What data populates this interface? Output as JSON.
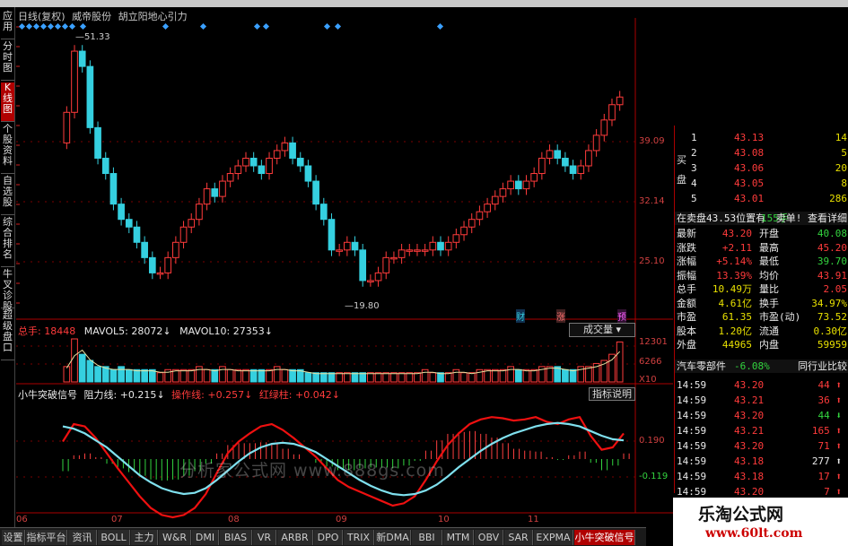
{
  "header": {
    "chart_mode": "日线(复权)",
    "stock_name": "威帝股份",
    "indicator_name": "胡立阳地心引力"
  },
  "left_tabs": [
    "应用",
    "分时图",
    "K线图",
    "个股资料",
    "自选股",
    "综合排名",
    "牛叉诊股",
    "超级盘口"
  ],
  "price_chart": {
    "high_label": "51.33",
    "low_label": "19.80",
    "axis_labels": [
      "39.09",
      "32.14",
      "25.10"
    ],
    "events": [
      "财",
      "涨",
      "预"
    ],
    "candles_open": [
      38,
      42,
      50,
      48,
      40,
      36,
      34,
      30,
      28,
      27,
      25,
      23,
      21,
      21,
      23,
      25,
      27,
      28,
      30,
      32,
      31,
      33,
      34,
      35,
      36,
      35,
      34,
      36,
      37,
      38,
      36,
      35,
      33,
      30,
      28,
      24,
      24,
      25,
      24,
      20,
      20,
      21,
      23,
      23,
      24,
      24,
      24,
      24,
      25,
      24,
      25,
      26,
      27,
      28,
      29,
      30,
      31,
      32,
      33,
      32,
      33,
      34,
      36,
      37,
      36,
      35,
      34,
      35,
      37,
      39,
      41,
      43
    ],
    "candles_close": [
      42,
      50,
      48,
      40,
      36,
      34,
      30,
      28,
      27,
      25,
      23,
      21,
      21,
      23,
      25,
      27,
      28,
      30,
      32,
      31,
      33,
      34,
      35,
      36,
      35,
      34,
      36,
      37,
      38,
      36,
      35,
      33,
      30,
      28,
      24,
      24,
      25,
      24,
      20,
      20,
      21,
      23,
      23,
      24,
      24,
      24,
      24,
      25,
      24,
      25,
      26,
      27,
      28,
      29,
      30,
      31,
      32,
      33,
      32,
      33,
      34,
      36,
      37,
      36,
      35,
      34,
      35,
      37,
      39,
      41,
      43,
      44
    ]
  },
  "volume_chart": {
    "label": "总手",
    "total": "18448",
    "mavol5_label": "MAVOL5:",
    "mavol5": "28072",
    "mavol10_label": "MAVOL10:",
    "mavol10": "27353",
    "axis_labels": [
      "12301",
      "6266",
      "X10"
    ],
    "dropdown": "成交量",
    "values": [
      5,
      14,
      9,
      7,
      5,
      5,
      4,
      5,
      4,
      4,
      4,
      4,
      3,
      4,
      4,
      4,
      4,
      5,
      4,
      4,
      5,
      4,
      4,
      4,
      4,
      4,
      4,
      5,
      4,
      4,
      4,
      3,
      3,
      3,
      3,
      3,
      3,
      3,
      3,
      3,
      3,
      3,
      3,
      3,
      3,
      3,
      4,
      3,
      3,
      3,
      4,
      3,
      3,
      4,
      4,
      4,
      4,
      5,
      4,
      4,
      4,
      5,
      5,
      5,
      4,
      4,
      5,
      5,
      6,
      7,
      9,
      13
    ]
  },
  "osc_chart": {
    "name": "小牛突破信号",
    "resist_label": "阻力线:",
    "resist": "+0.215",
    "op_label": "操作线:",
    "op": "+0.257",
    "red_label": "红绿柱:",
    "red": "+0.042",
    "button": "指标说明",
    "axis_labels": [
      "0.190",
      "-0.119"
    ],
    "watermark": "分析家公式网 www.888gs.com",
    "red_line": [
      0.15,
      0.3,
      0.28,
      0.18,
      0.05,
      -0.08,
      -0.2,
      -0.32,
      -0.42,
      -0.48,
      -0.5,
      -0.48,
      -0.42,
      -0.3,
      -0.12,
      0.05,
      0.15,
      0.22,
      0.28,
      0.3,
      0.25,
      0.18,
      0.1,
      0.02,
      -0.08,
      -0.18,
      -0.24,
      -0.28,
      -0.32,
      -0.36,
      -0.4,
      -0.38,
      -0.32,
      -0.18,
      -0.02,
      0.12,
      0.22,
      0.3,
      0.34,
      0.36,
      0.35,
      0.33,
      0.34,
      0.36,
      0.32,
      0.3,
      0.34,
      0.36,
      0.2,
      0.08,
      0.1,
      0.22
    ],
    "cyan_line": [
      0.28,
      0.26,
      0.22,
      0.16,
      0.1,
      0.02,
      -0.06,
      -0.14,
      -0.2,
      -0.25,
      -0.28,
      -0.3,
      -0.29,
      -0.25,
      -0.18,
      -0.1,
      -0.02,
      0.05,
      0.1,
      0.13,
      0.14,
      0.13,
      0.1,
      0.06,
      0.0,
      -0.06,
      -0.12,
      -0.18,
      -0.23,
      -0.27,
      -0.3,
      -0.31,
      -0.3,
      -0.27,
      -0.22,
      -0.15,
      -0.07,
      0.0,
      0.07,
      0.13,
      0.18,
      0.22,
      0.25,
      0.28,
      0.3,
      0.31,
      0.3,
      0.28,
      0.24,
      0.2,
      0.17,
      0.16
    ]
  },
  "x_axis": [
    "06",
    "07",
    "08",
    "09",
    "10",
    "11"
  ],
  "quote": {
    "buy_side": "买盘",
    "buy_levels": [
      {
        "n": "1",
        "price": "43.13",
        "vol": "14"
      },
      {
        "n": "2",
        "price": "43.08",
        "vol": "5"
      },
      {
        "n": "3",
        "price": "43.06",
        "vol": "20"
      },
      {
        "n": "4",
        "price": "43.05",
        "vol": "8"
      },
      {
        "n": "5",
        "price": "43.01",
        "vol": "286"
      }
    ],
    "sell_notice": "在卖盘43.53位置有",
    "sell_notice_vol": "155手",
    "sell_notice_tail": "卖单! 查看详细",
    "stats": [
      {
        "k1": "最新",
        "v1": "43.20",
        "k2": "开盘",
        "v2": "40.08"
      },
      {
        "k1": "涨跌",
        "v1": "+2.11",
        "k2": "最高",
        "v2": "45.20"
      },
      {
        "k1": "涨幅",
        "v1": "+5.14%",
        "k2": "最低",
        "v2": "39.70"
      },
      {
        "k1": "振幅",
        "v1": "13.39%",
        "k2": "均价",
        "v2": "43.91"
      },
      {
        "k1": "总手",
        "v1": "10.49万",
        "k2": "量比",
        "v2": "2.05"
      },
      {
        "k1": "金额",
        "v1": "4.61亿",
        "k2": "换手",
        "v2": "34.97%"
      },
      {
        "k1": "市盈",
        "v1": "61.35",
        "k2": "市盈(动)",
        "v2": "73.52"
      },
      {
        "k1": "股本",
        "v1": "1.20亿",
        "k2": "流通",
        "v2": "0.30亿"
      },
      {
        "k1": "外盘",
        "v1": "44965",
        "k2": "内盘",
        "v2": "59959"
      }
    ],
    "sector_name": "汽车零部件",
    "sector_change": "-6.08%",
    "sector_compare": "同行业比较",
    "ticks": [
      {
        "time": "14:59",
        "price": "43.20",
        "vol": "44",
        "dir": "up"
      },
      {
        "time": "14:59",
        "price": "43.21",
        "vol": "36",
        "dir": "up"
      },
      {
        "time": "14:59",
        "price": "43.20",
        "vol": "44",
        "dir": "down"
      },
      {
        "time": "14:59",
        "price": "43.21",
        "vol": "165",
        "dir": "up"
      },
      {
        "time": "14:59",
        "price": "43.20",
        "vol": "71",
        "dir": "up"
      },
      {
        "time": "14:59",
        "price": "43.18",
        "vol": "277",
        "dir": "white"
      },
      {
        "time": "14:59",
        "price": "43.18",
        "vol": "17",
        "dir": "up"
      },
      {
        "time": "14:59",
        "price": "43.20",
        "vol": "7",
        "dir": "up"
      }
    ]
  },
  "bottom_tabs": [
    "设置",
    "指标平台",
    "资讯",
    "BOLL",
    "主力",
    "W&R",
    "DMI",
    "BIAS",
    "VR",
    "ARBR",
    "DPO",
    "TRIX",
    "新DMA",
    "BBI",
    "MTM",
    "OBV",
    "SAR",
    "EXPMA",
    "小牛突破信号"
  ],
  "watermark": {
    "line1": "乐淘公式网",
    "line2": "www.60lt.com"
  },
  "colors": {
    "up": "#ff3b3b",
    "down": "#35d0e0",
    "grid": "#7a0000",
    "accent": "#b00000"
  }
}
